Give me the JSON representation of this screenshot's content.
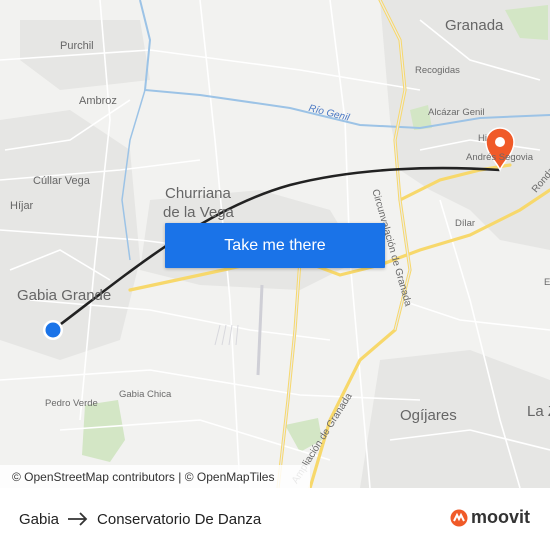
{
  "map": {
    "places": {
      "purchil": "Purchil",
      "ambroz": "Ambroz",
      "cullar_vega": "Cúllar Vega",
      "hijar": "Híjar",
      "gabia_grande": "Gabia Grande",
      "churriana_line1": "Churriana",
      "churriana_line2": "de la Vega",
      "granada": "Granada",
      "recogidas": "Recogidas",
      "alcazar_genil": "Alcázar Genil",
      "andres_segovia": "Andrés Segovia",
      "dilar": "Dílar",
      "ogijares": "Ogíjares",
      "pedro_verde": "Pedro Verde",
      "gabia_chica": "Gabia Chica",
      "la_zubia": "La Z",
      "ronda": "Ronda",
      "hi": "Hi",
      "e_edge": "E"
    },
    "roads": {
      "rio_genil": "Río Genil",
      "circunvalacion": "Circunvalación de Granada",
      "ampliacion": "Ampliación de Granada"
    },
    "colors": {
      "route_line": "#222222",
      "origin_dot": "#1a73e8",
      "destination_pin": "#f05a28",
      "road_major": "#f7d86b",
      "river": "#9cc3e6",
      "cta_bg": "#1a73e8"
    }
  },
  "cta": {
    "label": "Take me there"
  },
  "attribution": "© OpenStreetMap contributors | © OpenMapTiles",
  "route": {
    "from": "Gabia",
    "to": "Conservatorio De Danza"
  },
  "brand": {
    "name": "moovit"
  }
}
